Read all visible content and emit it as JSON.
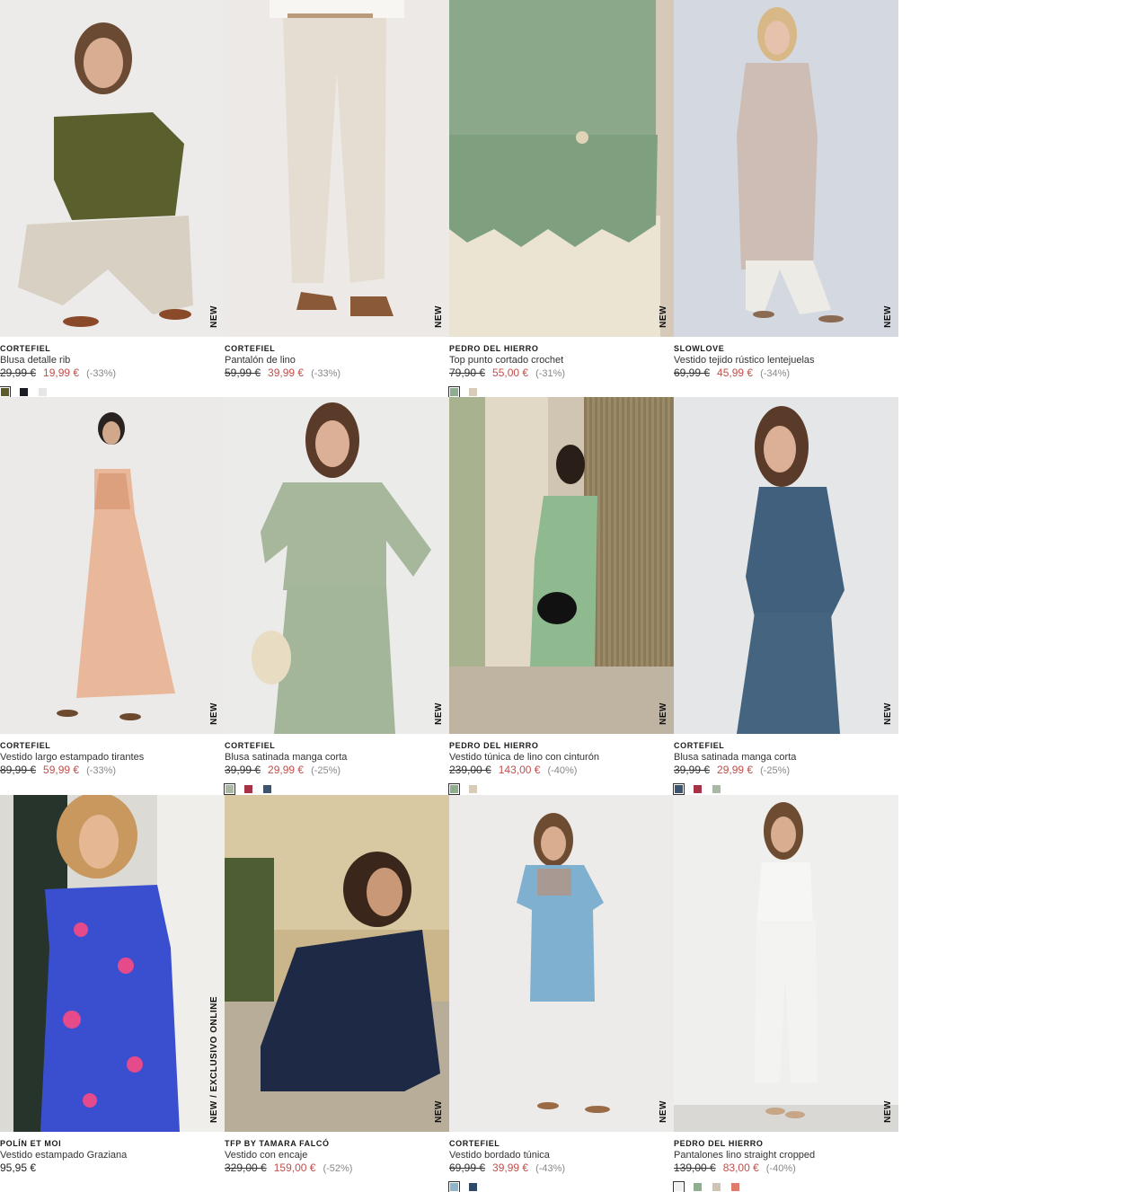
{
  "colors": {
    "sale_price": "#c0504d",
    "text": "#222222"
  },
  "products": [
    {
      "brand": "CORTEFIEL",
      "name": "Blusa detalle rib",
      "old_price": "29,99 €",
      "price": "19,99 €",
      "discount": "(-33%)",
      "badge": "NEW",
      "swatches": [
        "#5a5a2a",
        "#1c1c24",
        "#e6e6e6"
      ]
    },
    {
      "brand": "CORTEFIEL",
      "name": "Pantalón de lino",
      "old_price": "59,99 €",
      "price": "39,99 €",
      "discount": "(-33%)",
      "badge": "NEW",
      "swatches": []
    },
    {
      "brand": "PEDRO DEL HIERRO",
      "name": "Top punto cortado crochet",
      "old_price": "79,90 €",
      "price": "55,00 €",
      "discount": "(-31%)",
      "badge": "NEW",
      "swatches": [
        "#8fae8f",
        "#d8cbb7"
      ]
    },
    {
      "brand": "SLOWLOVE",
      "name": "Vestido tejido rústico lentejuelas",
      "old_price": "69,99 €",
      "price": "45,99 €",
      "discount": "(-34%)",
      "badge": "NEW",
      "swatches": []
    },
    {
      "brand": "CORTEFIEL",
      "name": "Vestido largo estampado tirantes",
      "old_price": "89,99 €",
      "price": "59,99 €",
      "discount": "(-33%)",
      "badge": "NEW",
      "swatches": []
    },
    {
      "brand": "CORTEFIEL",
      "name": "Blusa satinada manga corta",
      "old_price": "39,99 €",
      "price": "29,99 €",
      "discount": "(-25%)",
      "badge": "NEW",
      "swatches": [
        "#a9b9a3",
        "#a83245",
        "#3d5470"
      ]
    },
    {
      "brand": "PEDRO DEL HIERRO",
      "name": "Vestido túnica de lino con cinturón",
      "old_price": "239,00 €",
      "price": "143,00 €",
      "discount": "(-40%)",
      "badge": "NEW",
      "swatches": [
        "#8fae8f",
        "#d8cbb7"
      ]
    },
    {
      "brand": "CORTEFIEL",
      "name": "Blusa satinada manga corta",
      "old_price": "39,99 €",
      "price": "29,99 €",
      "discount": "(-25%)",
      "badge": "NEW",
      "swatches": [
        "#3d5470",
        "#a83245",
        "#a9b9a3"
      ]
    },
    {
      "brand": "POLÍN ET MOI",
      "name": "Vestido estampado Graziana",
      "old_price": "",
      "price": "95,95 €",
      "discount": "",
      "badge": "NEW / EXCLUSIVO ONLINE",
      "swatches": []
    },
    {
      "brand": "TFP BY TAMARA FALCÓ",
      "name": "Vestido con encaje",
      "old_price": "329,00 €",
      "price": "159,00 €",
      "discount": "(-52%)",
      "badge": "NEW",
      "swatches": []
    },
    {
      "brand": "CORTEFIEL",
      "name": "Vestido bordado túnica",
      "old_price": "69,99 €",
      "price": "39,99 €",
      "discount": "(-43%)",
      "badge": "NEW",
      "swatches": [
        "#8fb5cc",
        "#2e4a66"
      ]
    },
    {
      "brand": "PEDRO DEL HIERRO",
      "name": "Pantalones lino straight cropped",
      "old_price": "139,00 €",
      "price": "83,00 €",
      "discount": "(-40%)",
      "badge": "NEW",
      "swatches": [
        "#f0f0f0",
        "#8fae8f",
        "#cfc3b4",
        "#e07a6a"
      ]
    }
  ]
}
